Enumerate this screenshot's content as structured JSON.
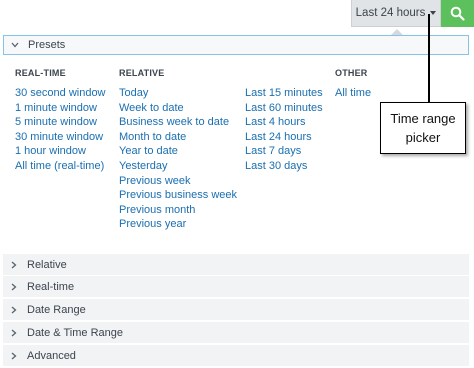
{
  "topbar": {
    "time_range_label": "Last 24 hours",
    "accent_color": "#5cc05c"
  },
  "presets": {
    "header_label": "Presets",
    "columns": {
      "realtime": {
        "title": "REAL-TIME",
        "items": [
          "30 second window",
          "1 minute window",
          "5 minute window",
          "30 minute window",
          "1 hour window",
          "All time (real-time)"
        ]
      },
      "relative": {
        "title": "RELATIVE",
        "items": [
          "Today",
          "Week to date",
          "Business week to date",
          "Month to date",
          "Year to date",
          "Yesterday",
          "Previous week",
          "Previous business week",
          "Previous month",
          "Previous year"
        ]
      },
      "relative2": {
        "items": [
          "Last 15 minutes",
          "Last 60 minutes",
          "Last 4 hours",
          "Last 24 hours",
          "Last 7 days",
          "Last 30 days"
        ]
      },
      "other": {
        "title": "OTHER",
        "items": [
          "All time"
        ]
      }
    }
  },
  "sections": [
    "Relative",
    "Real-time",
    "Date Range",
    "Date & Time Range",
    "Advanced"
  ],
  "callout": {
    "line1": "Time range",
    "line2": "picker"
  },
  "colors": {
    "link": "#1a6fb0",
    "header_border": "#85c4e6",
    "section_bg": "#f2f3f5",
    "button_bg": "#e1e4e7"
  }
}
